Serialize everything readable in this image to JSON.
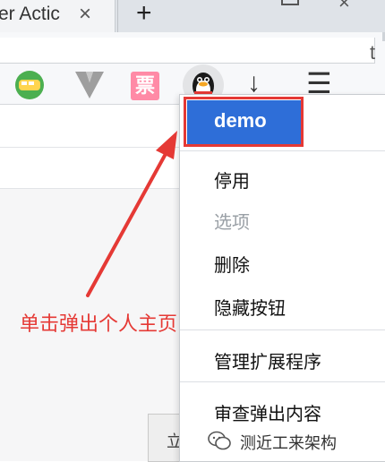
{
  "tab": {
    "title": "er Actic",
    "close_glyph": "×"
  },
  "new_tab_glyph": "+",
  "toolbar_fragment": "t",
  "extensions": [
    {
      "name": "train-extension-icon"
    },
    {
      "name": "v-extension-icon"
    },
    {
      "name": "ticket-extension-icon",
      "label": "票"
    },
    {
      "name": "qq-penguin-icon"
    },
    {
      "name": "download-icon",
      "glyph": "↓"
    },
    {
      "name": "menu-icon",
      "glyph": "☰"
    }
  ],
  "context_menu": {
    "demo": "demo",
    "stop": "停用",
    "options": "选项",
    "delete": "删除",
    "hide": "隐藏按钮",
    "manage": "管理扩展程序",
    "inspect": "审查弹出内容"
  },
  "annotation": {
    "text": "单击弹出个人主页",
    "color": "#e53935"
  },
  "page_button": {
    "label": "立即更"
  },
  "watermark": {
    "text": "测近工来架构"
  },
  "colors": {
    "accent": "#2e6ed8",
    "annotation": "#e53935",
    "disabled": "#9aa0a6"
  }
}
